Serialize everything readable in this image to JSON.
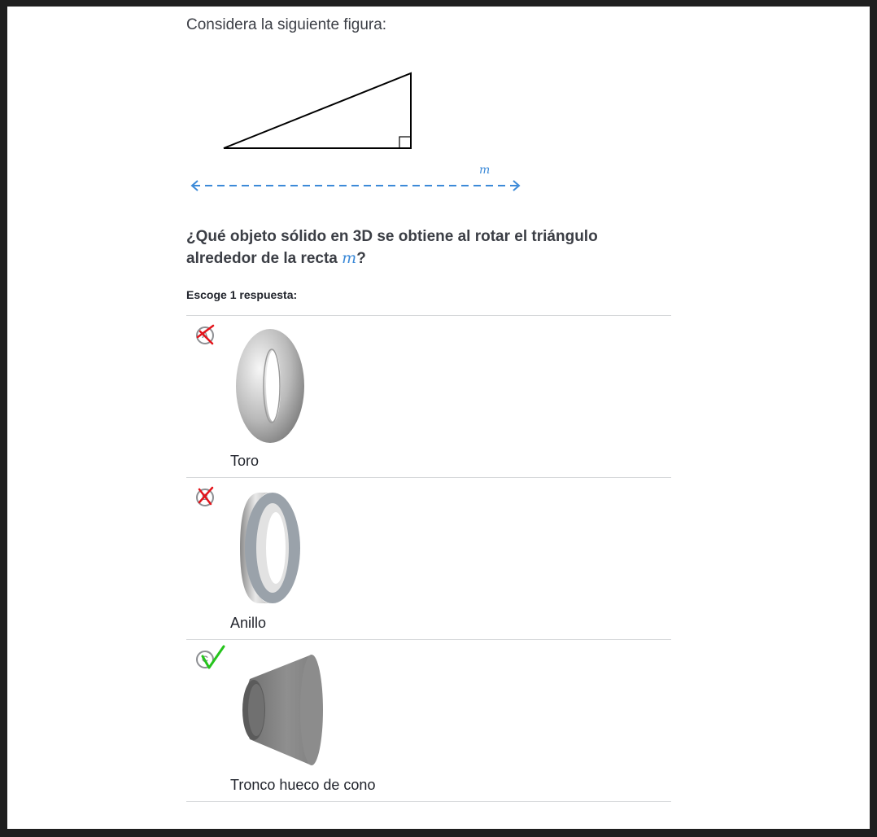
{
  "intro": "Considera la siguiente figura:",
  "figure": {
    "line_label": "m"
  },
  "question": {
    "text_before": "¿Qué objeto sólido en 3D se obtiene al rotar el triángulo alrededor de la recta ",
    "variable": "m",
    "text_after": "?"
  },
  "instructions": "Escoge 1 respuesta:",
  "choices": [
    {
      "letter": "A",
      "label": "Toro",
      "image": "torus-image",
      "status": "incorrect"
    },
    {
      "letter": "B",
      "label": "Anillo",
      "image": "ring-image",
      "status": "incorrect"
    },
    {
      "letter": "C",
      "label": "Tronco hueco de cono",
      "image": "hollow-frustum-image",
      "status": "correct"
    }
  ],
  "colors": {
    "accent": "#3c8ad8",
    "incorrect_mark": "#e3141b",
    "correct_mark": "#25c41c",
    "divider": "#d6d8da"
  }
}
